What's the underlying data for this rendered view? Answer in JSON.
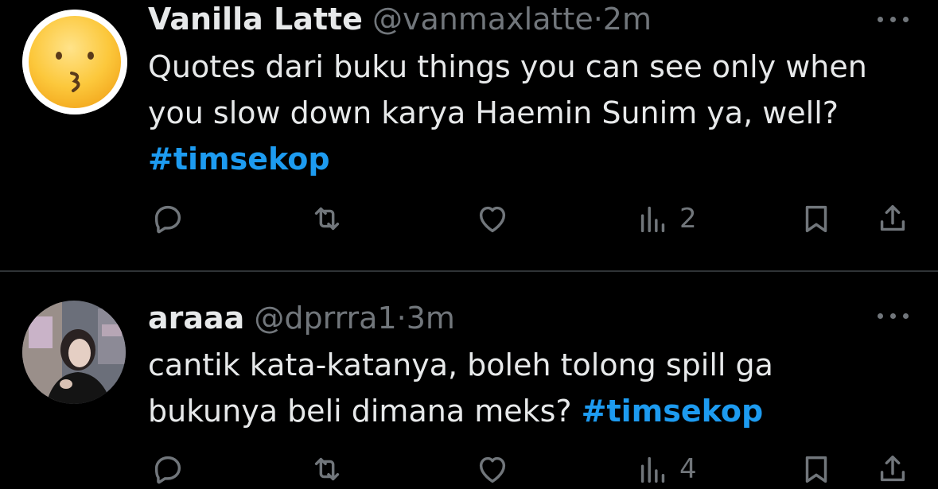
{
  "tweets": [
    {
      "name": "Vanilla Latte",
      "handle": "@vanmaxlatte",
      "dot": "·",
      "time": "2m",
      "avatar": "kissing-face-emoji",
      "text_lines": [
        "Quotes dari buku things you can see only when",
        "you slow down karya Haemin Sunim ya, well?"
      ],
      "hashtag": "#timsekop",
      "views": "2"
    },
    {
      "name": "araaa",
      "handle": "@dprrra1",
      "dot": "·",
      "time": "3m",
      "avatar": "user-photo",
      "text_lines": [
        "cantik kata-katanya, boleh tolong spill ga",
        "bukunya beli dimana meks? "
      ],
      "hashtag": "#timsekop",
      "views": "4"
    }
  ],
  "icons": {
    "reply": "reply-icon",
    "retweet": "retweet-icon",
    "like": "like-icon",
    "views": "views-icon",
    "bookmark": "bookmark-icon",
    "share": "share-icon",
    "more": "more-icon"
  },
  "colors": {
    "background": "#000000",
    "text": "#e7e9ea",
    "muted": "#71767b",
    "hashtag": "#1d9bf0",
    "divider": "#2f3336"
  }
}
